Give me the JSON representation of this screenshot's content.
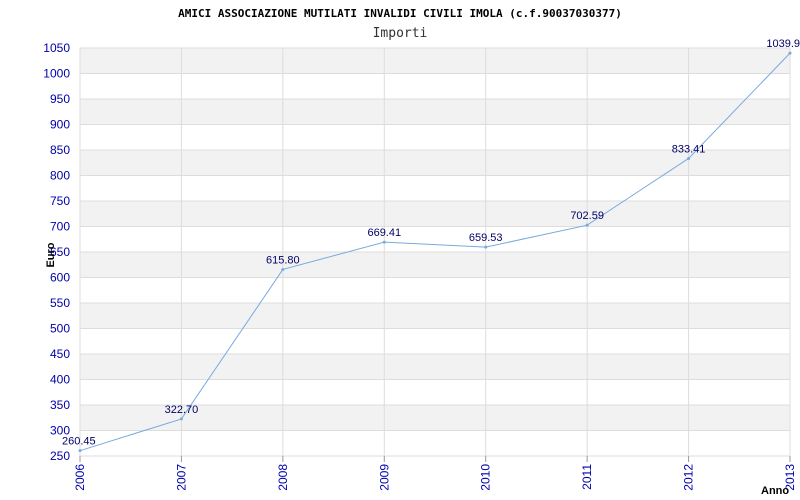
{
  "chart_data": {
    "type": "line",
    "title": "AMICI ASSOCIAZIONE MUTILATI INVALIDI CIVILI IMOLA (c.f.90037030377)",
    "subtitle": "Importi",
    "xlabel": "Anno",
    "ylabel": "Euro",
    "x": [
      "2006",
      "2007",
      "2008",
      "2009",
      "2010",
      "2011",
      "2012",
      "2013"
    ],
    "values": [
      260.45,
      322.7,
      615.8,
      669.41,
      659.53,
      702.59,
      833.41,
      1039.9
    ],
    "value_labels": [
      "260.45",
      "322.70",
      "615.80",
      "669.41",
      "659.53",
      "702.59",
      "833.41",
      "1039.9"
    ],
    "ylim": [
      250,
      1050
    ],
    "yticks": [
      250,
      300,
      350,
      400,
      450,
      500,
      550,
      600,
      650,
      700,
      750,
      800,
      850,
      900,
      950,
      1000,
      1050
    ],
    "grid": true,
    "colors": {
      "line": "#77aadd",
      "band": "#f2f2f2",
      "grid": "#dddddd",
      "tick": "#0000aa",
      "label": "#000066"
    }
  }
}
